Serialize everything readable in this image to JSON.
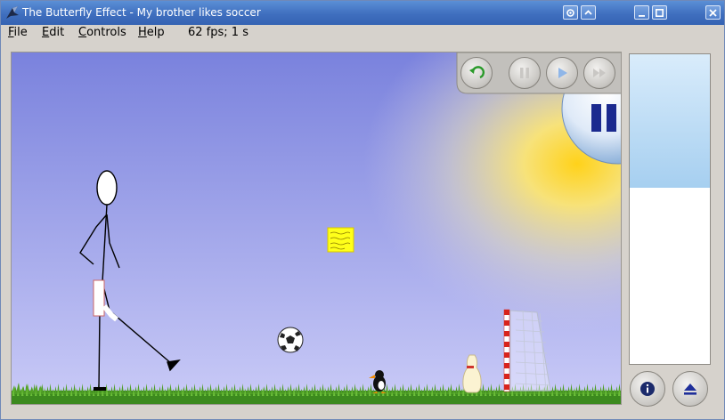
{
  "window": {
    "title": "The Butterfly Effect - My brother likes soccer",
    "buttons": [
      "settings-icon",
      "shade-up-icon",
      "minimize-icon",
      "maximize-icon",
      "close-icon"
    ]
  },
  "menubar": {
    "items": [
      {
        "label": "File",
        "accel": "F",
        "rest": "ile"
      },
      {
        "label": "Edit",
        "accel": "E",
        "rest": "dit"
      },
      {
        "label": "Controls",
        "accel": "C",
        "rest": "ontrols"
      },
      {
        "label": "Help",
        "accel": "H",
        "rest": "elp"
      }
    ],
    "status": "62 fps; 1 s"
  },
  "controls": {
    "icons": [
      "undo-icon",
      "pause-icon",
      "play-icon",
      "fast-forward-icon"
    ],
    "paused_indicator": "pause-icon"
  },
  "side_panel": {
    "buttons": [
      "info-icon",
      "eject-icon"
    ]
  },
  "colors": {
    "sky_top": "#7d86dc",
    "sky_bottom": "#c7c9f6",
    "sun": "#ffd836",
    "grass": "#3f8f20",
    "note": "#ffff1a",
    "titlebar": "#4a7ccc",
    "accent_blue": "#1b2a8f"
  }
}
